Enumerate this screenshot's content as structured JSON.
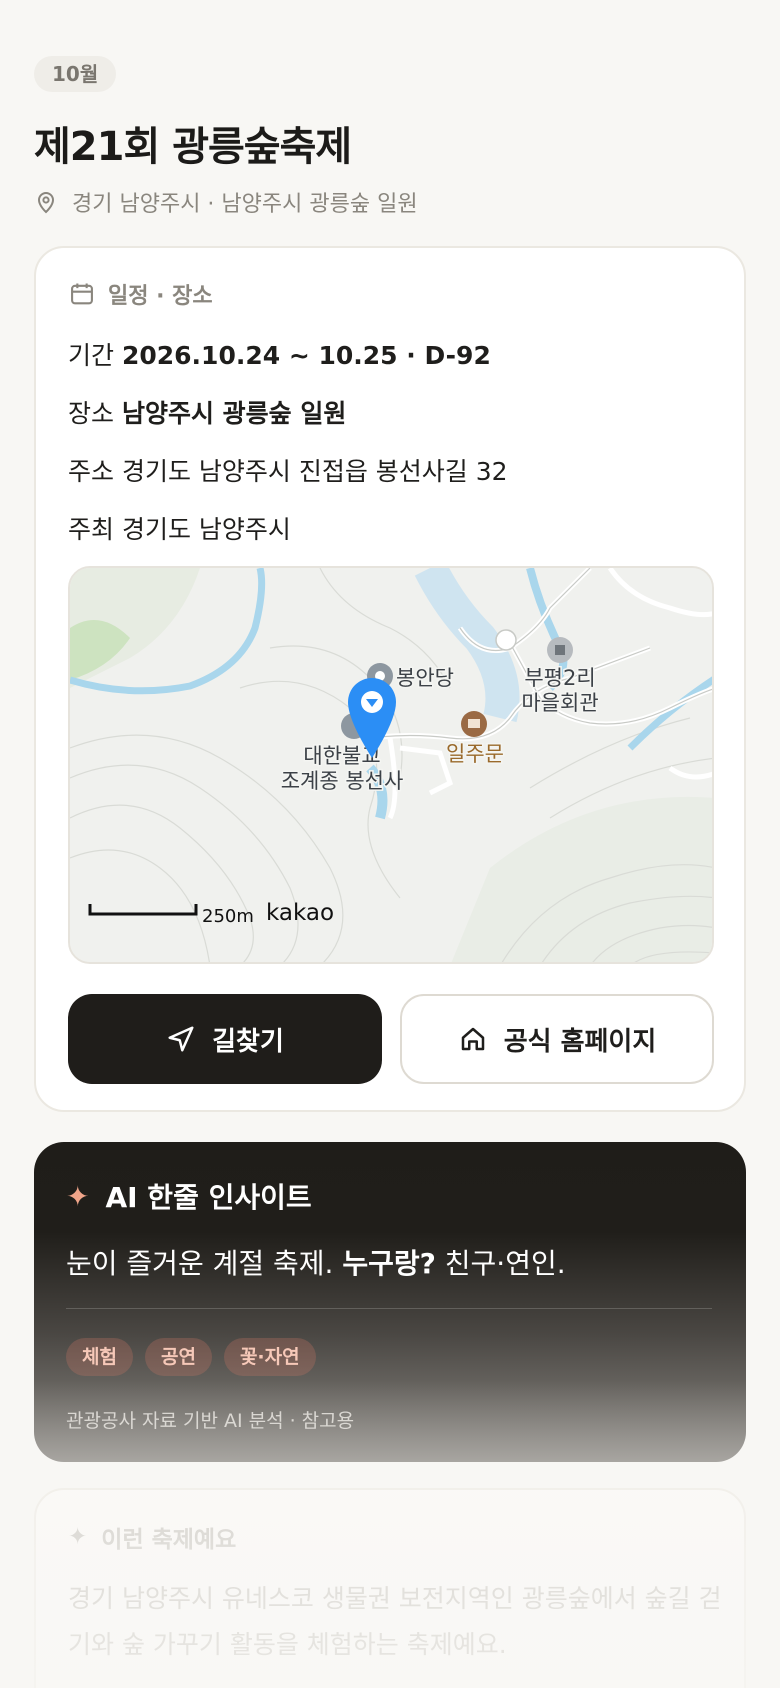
{
  "header": {
    "month_chip": "10월",
    "title": "제21회 광릉숲축제",
    "location": "경기 남양주시 · 남양주시 광릉숲 일원"
  },
  "info_card": {
    "heading": "일정 · 장소",
    "period_label": "기간",
    "period_value": "2026.10.24 ~ 10.25 · D-92",
    "venue_label": "장소",
    "venue_value": "남양주시 광릉숲 일원",
    "address_label": "주소",
    "address_value": "경기도 남양주시 진접읍 봉선사길 32",
    "host_label": "주최",
    "host_value": "경기도 남양주시",
    "map": {
      "poi_1": "봉안당",
      "poi_2_line1": "부평2리",
      "poi_2_line2": "마을회관",
      "poi_3_line1": "대한불교",
      "poi_3_line2": "조계종 봉선사",
      "poi_4": "일주문",
      "scale": "250m",
      "provider": "kakao"
    },
    "directions_label": "길찾기",
    "homepage_label": "공식 홈페이지"
  },
  "ai_card": {
    "heading": "AI 한줄 인사이트",
    "text_part1": "눈이 즐거운 계절 축제. ",
    "text_bold": "누구랑?",
    "text_part2": " 친구·연인.",
    "tags": [
      "체험",
      "공연",
      "꽃·자연"
    ],
    "footnote": "관광공사 자료 기반 AI 분석 · 참고용"
  },
  "desc_card": {
    "heading": "이런 축제예요",
    "text": "경기 남양주시 유네스코 생물권 보전지역인 광릉숲에서 숲길 걷기와 숲 가꾸기 활동을 체험하는 축제예요."
  },
  "colors": {
    "background": "#f8f7f4",
    "primary_dark": "#1f1d1a",
    "accent": "#f0a58a",
    "map_pin": "#2b8ef5"
  }
}
